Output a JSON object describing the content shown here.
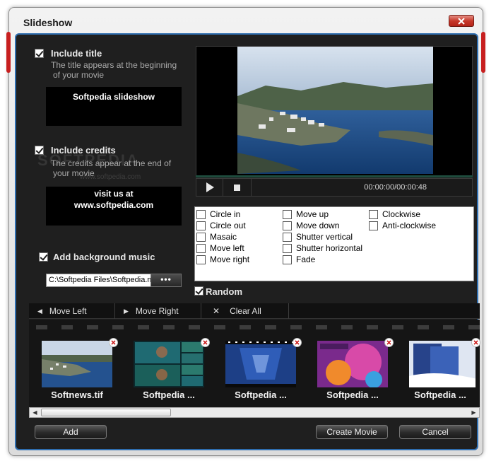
{
  "window": {
    "title": "Slideshow"
  },
  "title_section": {
    "checkbox_label": "Include title",
    "description_line1": "The title appears at the beginning",
    "description_line2": "of your movie",
    "text": "Softpedia slideshow"
  },
  "credits_section": {
    "checkbox_label": "Include credits",
    "description_line1": "The credits appear at the end of",
    "description_line2": "your movie",
    "text_line1": "visit us at",
    "text_line2": "www.softpedia.com"
  },
  "watermark": {
    "main": "SOFTPEDIA",
    "sub": "www.softpedia.com"
  },
  "music_section": {
    "checkbox_label": "Add background music",
    "path_value": "C:\\Softpedia Files\\Softpedia.mp3",
    "browse_label": "•••"
  },
  "player": {
    "time": "00:00:00/00:00:48"
  },
  "transitions": {
    "col1": [
      "Circle in",
      "Circle out",
      "Masaic",
      "Move left",
      "Move right"
    ],
    "col2": [
      "Move up",
      "Move down",
      "Shutter vertical",
      "Shutter horizontal",
      "Fade"
    ],
    "col3": [
      "Clockwise",
      "Anti-clockwise"
    ],
    "random_label": "Random"
  },
  "toolbar": {
    "move_left": "Move Left",
    "move_right": "Move Right",
    "clear_all": "Clear All"
  },
  "filmstrip": {
    "items": [
      {
        "label": "Softnews.tif"
      },
      {
        "label": "Softpedia ..."
      },
      {
        "label": "Softpedia ..."
      },
      {
        "label": "Softpedia ..."
      },
      {
        "label": "Softpedia ..."
      }
    ]
  },
  "buttons": {
    "add": "Add",
    "create_movie": "Create Movie",
    "cancel": "Cancel"
  },
  "colors": {
    "frame_accent": "#2f6eb0",
    "close_red": "#c7392b",
    "dark_bg": "#1f1f1f"
  },
  "icons": {
    "close": "close-icon",
    "play": "play-icon",
    "stop": "stop-icon",
    "move_left": "triangle-left-icon",
    "move_right": "triangle-right-icon",
    "clear_all": "x-icon",
    "remove_thumb": "remove-icon"
  }
}
